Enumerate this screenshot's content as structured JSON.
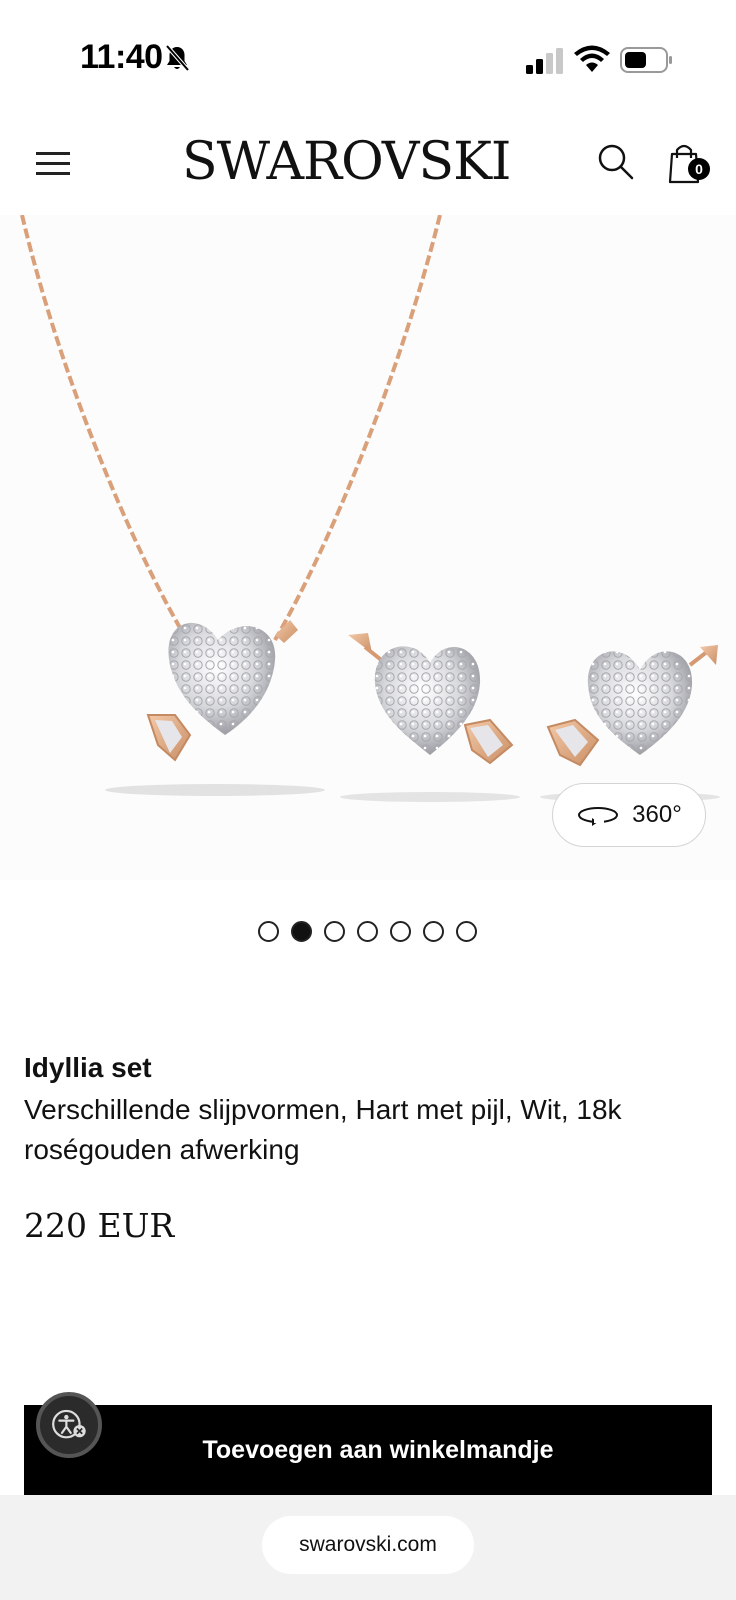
{
  "status_bar": {
    "time": "11:40",
    "icons": [
      "bell-off-icon",
      "signal-icon",
      "wifi-icon",
      "battery-icon"
    ]
  },
  "header": {
    "logo": "SWAROVSKI",
    "cart_count": "0",
    "icons": [
      "menu-icon",
      "search-icon",
      "shopping-bag-icon"
    ]
  },
  "product": {
    "view_360_label": "360°",
    "image_count": 7,
    "active_image_index": 1,
    "name": "Idyllia set",
    "description": "Verschillende slijpvormen, Hart met pijl, Wit, 18k roségouden afwerking",
    "price": "220 EUR",
    "add_to_cart_label": "Toevoegen aan winkelmandje"
  },
  "browser": {
    "url": "swarovski.com"
  },
  "colors": {
    "button_bg": "#000000",
    "rose_gold": "#e0a883",
    "crystal": "#d8d8dc"
  }
}
